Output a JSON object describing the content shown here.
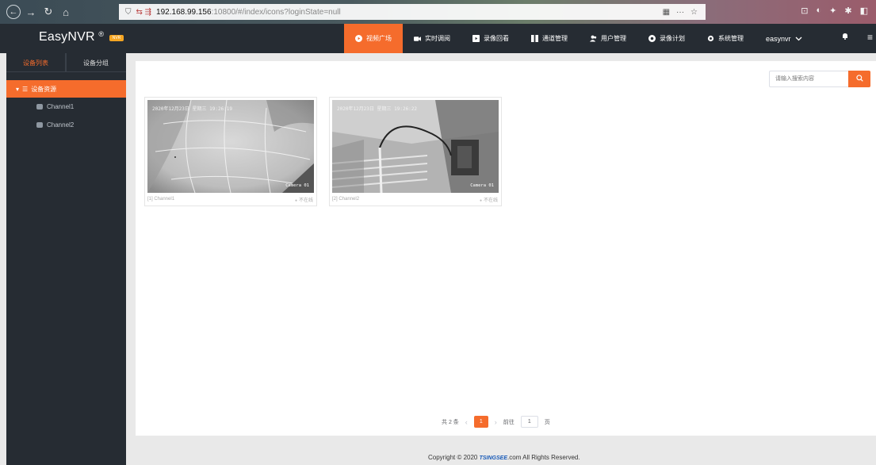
{
  "browser": {
    "url_host": "192.168.99.156",
    "url_rest": ":10800/#/index/icons?loginState=null",
    "url_prefix": "⇆ ⇶"
  },
  "header": {
    "brand": "EasyNVR",
    "brand_mark": "®",
    "version_badge": "NVR",
    "nav": [
      {
        "label": "视频广场",
        "active": true
      },
      {
        "label": "实时调阅"
      },
      {
        "label": "录像回看"
      },
      {
        "label": "通道管理"
      },
      {
        "label": "用户管理"
      },
      {
        "label": "录像计划"
      },
      {
        "label": "系统管理"
      }
    ],
    "user": "easynvr"
  },
  "sidebar": {
    "tabs": [
      {
        "label": "设备列表",
        "active": true
      },
      {
        "label": "设备分组"
      }
    ],
    "root": "设备资源",
    "items": [
      {
        "label": "Channel1"
      },
      {
        "label": "Channel2"
      }
    ]
  },
  "main": {
    "search_placeholder": "请输入搜索内容",
    "cards": [
      {
        "stamp": "2020年12月23日  星期三  19:26:19",
        "camera": "Camera 01",
        "name": "[1] Channel1",
        "status": "不在线"
      },
      {
        "stamp": "2020年12月23日  星期三  19:26:22",
        "camera": "Camera 01",
        "name": "[2] Channel2",
        "status": "不在线"
      }
    ],
    "pager": {
      "total": "共 2 条",
      "current": "1",
      "goto_label": "前往",
      "goto_value": "1",
      "page_unit": "页"
    }
  },
  "footer": {
    "prefix": "Copyright © 2020",
    "logo": "TSINGSEE",
    "suffix": ".com All Rights Reserved."
  },
  "colors": {
    "accent": "#f56c2c",
    "header_bg": "#262c33"
  }
}
